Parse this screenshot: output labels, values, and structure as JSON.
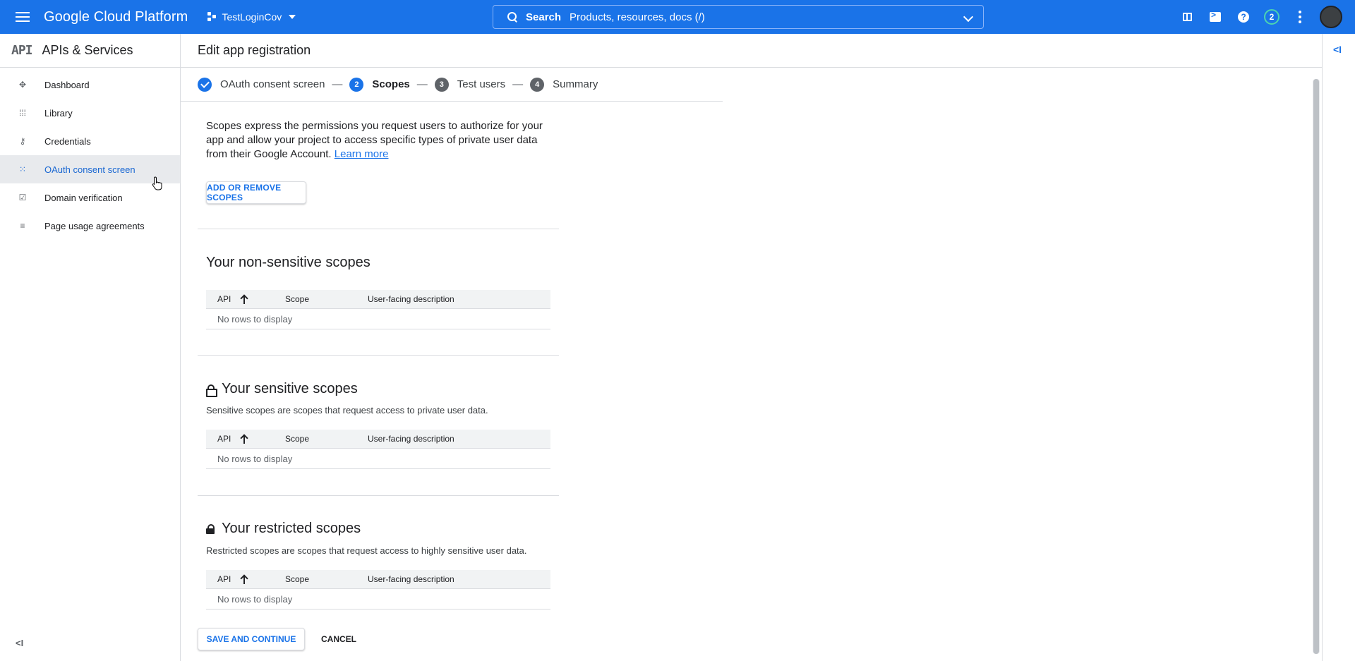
{
  "topbar": {
    "brand": "Google Cloud Platform",
    "project": "TestLoginCov",
    "search_label": "Search",
    "search_placeholder": "Products, resources, docs (/)",
    "notification_count": "2",
    "colors": {
      "bar": "#1a73e8"
    }
  },
  "sidebar": {
    "logo": "API",
    "title": "APIs & Services",
    "items": [
      {
        "label": "Dashboard",
        "icon": "dashboard-icon"
      },
      {
        "label": "Library",
        "icon": "library-icon"
      },
      {
        "label": "Credentials",
        "icon": "key-icon"
      },
      {
        "label": "OAuth consent screen",
        "icon": "consent-icon",
        "active": true
      },
      {
        "label": "Domain verification",
        "icon": "checkbox-icon"
      },
      {
        "label": "Page usage agreements",
        "icon": "settings-list-icon"
      }
    ]
  },
  "page": {
    "title": "Edit app registration"
  },
  "stepper": {
    "steps": [
      {
        "number": "",
        "label": "OAuth consent screen",
        "state": "done"
      },
      {
        "number": "2",
        "label": "Scopes",
        "state": "current"
      },
      {
        "number": "3",
        "label": "Test users",
        "state": "todo"
      },
      {
        "number": "4",
        "label": "Summary",
        "state": "todo"
      }
    ],
    "separator": "—"
  },
  "content": {
    "description": "Scopes express the permissions you request users to authorize for your app and allow your project to access specific types of private user data from their Google Account.",
    "learn_more": "Learn more",
    "add_remove_button": "ADD OR REMOVE SCOPES",
    "sections": [
      {
        "title": "Your non-sensitive scopes",
        "subtitle": "",
        "columns": [
          "API",
          "Scope",
          "User-facing description"
        ],
        "empty": "No rows to display"
      },
      {
        "title": "Your sensitive scopes",
        "subtitle": "Sensitive scopes are scopes that request access to private user data.",
        "columns": [
          "API",
          "Scope",
          "User-facing description"
        ],
        "empty": "No rows to display"
      },
      {
        "title": "Your restricted scopes",
        "subtitle": "Restricted scopes are scopes that request access to highly sensitive user data.",
        "columns": [
          "API",
          "Scope",
          "User-facing description"
        ],
        "empty": "No rows to display"
      }
    ],
    "save_button": "SAVE AND CONTINUE",
    "cancel_button": "CANCEL"
  }
}
